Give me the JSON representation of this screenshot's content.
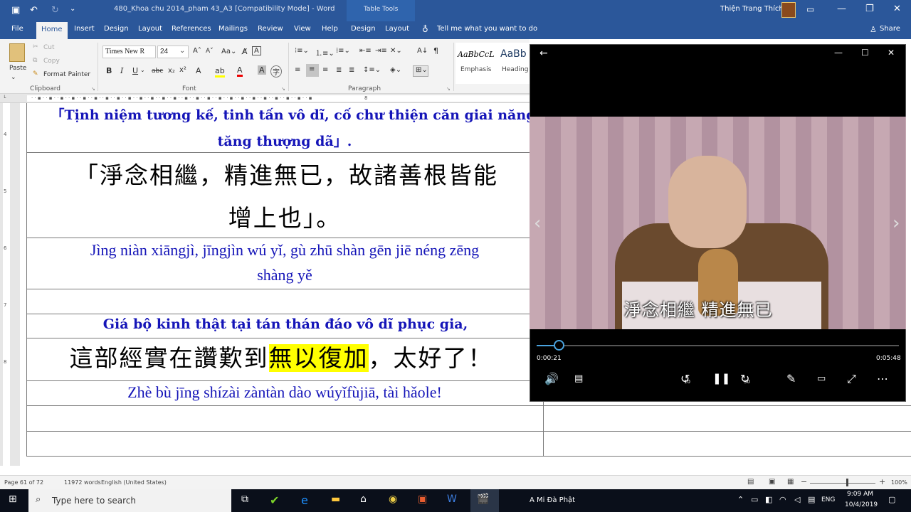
{
  "title_bar": {
    "doc_title": "480_Khoa chu 2014_pham 43_A3 [Compatibility Mode]  -  Word",
    "context_tab": "Table Tools",
    "user_name": "Thiện Trang Thích",
    "minimize": "—",
    "restore": "❐",
    "close": "✕"
  },
  "ribbon_tabs": [
    "File",
    "Home",
    "Insert",
    "Design",
    "Layout",
    "References",
    "Mailings",
    "Review",
    "View",
    "Help",
    "Design",
    "Layout"
  ],
  "tell_me": "Tell me what you want to do",
  "share": "Share",
  "clipboard": {
    "paste": "Paste",
    "cut": "Cut",
    "copy": "Copy",
    "format_painter": "Format Painter",
    "group": "Clipboard"
  },
  "font": {
    "name": "Times New R",
    "size": "24",
    "group": "Font"
  },
  "paragraph": {
    "group": "Paragraph"
  },
  "styles": [
    {
      "preview": "AaBbCcL",
      "name": "Emphasis"
    },
    {
      "preview": "AaBb",
      "name": "Heading"
    }
  ],
  "ruler_marks": [
    "4",
    "5",
    "6",
    "7",
    "8"
  ],
  "document": {
    "row1_viet_a": "「Tịnh niệm tương kế, tinh tấn vô dĩ, cố chư thiện căn giai năng",
    "row1_viet_b": "tăng thượng dã」.",
    "row2_han_a": "「淨念相繼，精進無已，故諸善根皆能",
    "row2_han_b": "增上也」。",
    "row3_pin_a": "Jìng niàn xiāngjì, jīngjìn wú yǐ, gù zhū shàn gēn jiē néng zēng",
    "row3_pin_b": "shàng yě",
    "row5_viet": "Giá bộ kinh thật tại tán thán đáo vô dĩ phục gia,",
    "row6_han_pre": "這部經實在讚歎到",
    "row6_han_hl": "無以復加",
    "row6_han_post": "，太好了！",
    "row7_pin": "Zhè bù jīng shízài zàntàn dào wúyǐfùjiā, tài hǎole!"
  },
  "status": {
    "page": "Page 61 of 72",
    "words": "11972 words",
    "language": "English (United States)",
    "zoom": "100%"
  },
  "player": {
    "subtitle": "淨念相繼  精進無已",
    "current_time": "0:00:21",
    "total_time": "0:05:48",
    "progress": 0.06,
    "back": "←",
    "prev": "‹",
    "next": "›",
    "skip_back": "10",
    "skip_forward": "30"
  },
  "taskbar": {
    "search_placeholder": "Type here to search",
    "running_app": "A Mi Đà Phật",
    "language": "ENG",
    "time": "9:09 AM",
    "date": "10/4/2019"
  },
  "colors": {
    "word_blue": "#2b579a",
    "doc_blue_text": "#1515b8",
    "highlight": "#ffff00",
    "player_accent": "#4aa3df"
  }
}
